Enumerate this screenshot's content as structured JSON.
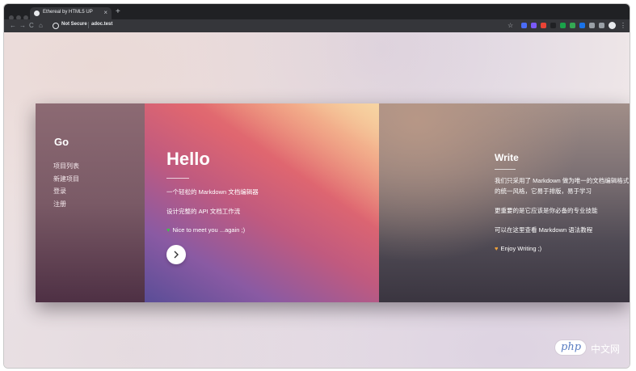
{
  "browser": {
    "tab_title": "Ethereal by HTML5 UP",
    "tab_close": "×",
    "new_tab": "+",
    "security": "Not Secure",
    "url": "adoc.test",
    "nav": {
      "back": "←",
      "forward": "→",
      "reload": "C",
      "home": "⌂"
    },
    "star": "☆",
    "menu": "⋮",
    "extension_colors": [
      "#4a6cf7",
      "#7a5af8",
      "#ea4335",
      "#202124",
      "#1aa34a",
      "#34a853",
      "#1a73e8",
      "#9aa0a6",
      "#9aa0a6"
    ]
  },
  "go_panel": {
    "title": "Go",
    "items": [
      "项目列表",
      "新建项目",
      "登录",
      "注册"
    ]
  },
  "hello_panel": {
    "title": "Hello",
    "line1": "一个轻松的 Markdown 文档编辑器",
    "line2": "设计完整的 API 文档工作流",
    "line3": "Nice to meet you ...again ;)",
    "heart": "♥",
    "next_icon": "chevron-right-icon"
  },
  "write_panel": {
    "title": "Write",
    "line1": "我们只采用了 Markdown 做为唯一的文档编辑格式",
    "line1b": "的统一风格，它易于排版，易于学习",
    "line2": "更重要的是它应该是你必备的专业技能",
    "line3": "可以在这里查看 Markdown 语法教程",
    "line4": "Enjoy Writing ;)",
    "heart": "♥"
  },
  "watermark": {
    "badge": "php",
    "text": "中文网"
  },
  "colors": {
    "chrome_dark": "#202124",
    "toolbar": "#35363a",
    "go_panel": "#7a5a66",
    "hello_accent": "#df6670",
    "heart_green": "#3fbf4b",
    "heart_orange": "#f0a23a"
  }
}
